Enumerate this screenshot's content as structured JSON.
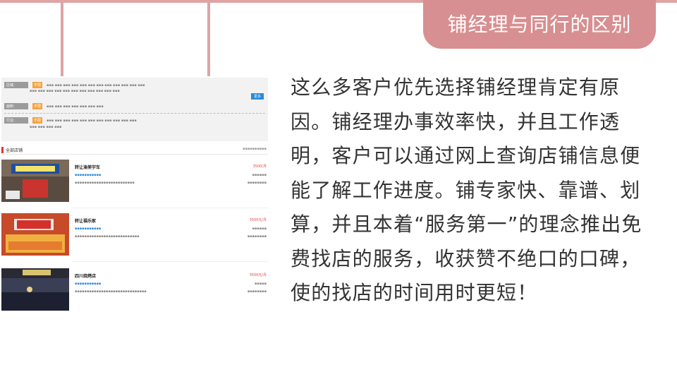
{
  "header": {
    "tab_title": "铺经理与同行的区别"
  },
  "paragraph": "这么多客户优先选择铺经理肯定有原因。铺经理办事效率快，并且工作透明，客户可以通过网上查询店铺信息便能了解工作进度。铺专家快、靠谱、划算，并且本着“服务第一”的理念推出免费找店的服务，收获赞不绝口的口碑，使的找店的时间用时更短！",
  "screenshot": {
    "filters": [
      {
        "label": "区域:",
        "selected": "不限"
      },
      {
        "label": "面积:",
        "selected": "不限"
      },
      {
        "label": "行业:",
        "selected": "不限"
      }
    ],
    "more_label": "更多",
    "section_title": "全部店铺",
    "listings": [
      {
        "title": "转让渝美宇车",
        "price": "3500/月"
      },
      {
        "title": "转让福乐家",
        "price": "3500元/月"
      },
      {
        "title": "四川烧烤店",
        "price": "3500元/月"
      }
    ]
  },
  "colors": {
    "accent": "#d88f91",
    "line": "#dfa4a6",
    "text": "#333333"
  }
}
